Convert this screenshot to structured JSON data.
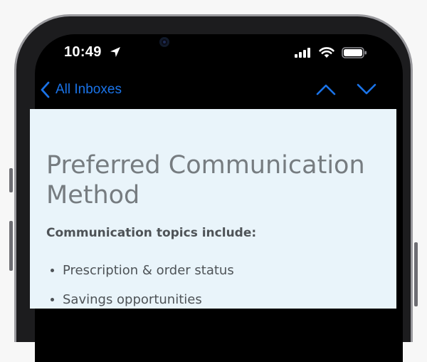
{
  "status_bar": {
    "time": "10:49",
    "location_icon": "location-arrow-icon",
    "signal_icon": "cellular-signal-icon",
    "wifi_icon": "wifi-icon",
    "battery_icon": "battery-icon"
  },
  "nav": {
    "back_label": "All Inboxes",
    "back_icon": "chevron-left-icon",
    "previous_icon": "chevron-up-icon",
    "next_icon": "chevron-down-icon",
    "accent_color": "#1a73e8"
  },
  "email": {
    "title": "Preferred Communication Method",
    "topics_heading": "Communication topics include:",
    "topics": [
      "Prescription & order status",
      "Savings opportunities"
    ],
    "background_color": "#e9f4fa"
  }
}
